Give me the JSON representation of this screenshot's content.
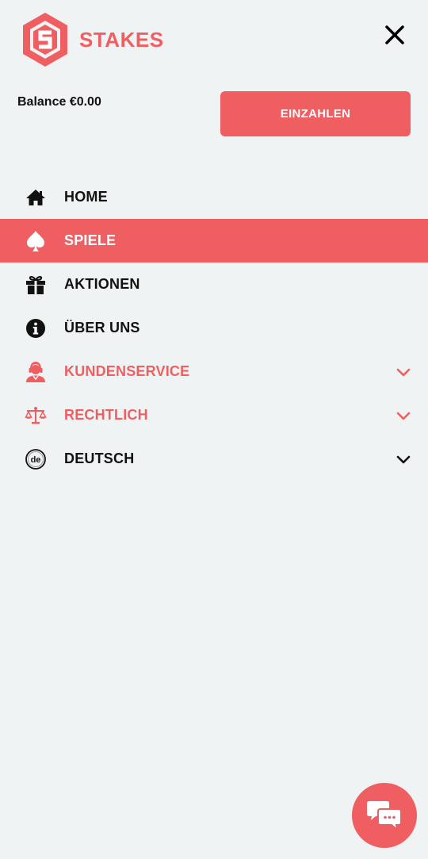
{
  "brand": {
    "name": "STAKES",
    "accent_color": "#ef5f62"
  },
  "header": {
    "close_icon": "close-icon"
  },
  "account": {
    "balance_text": "Balance €0.00",
    "deposit_label": "EINZAHLEN"
  },
  "menu": {
    "items": [
      {
        "label": "HOME",
        "icon": "home-icon",
        "active": false
      },
      {
        "label": "SPIELE",
        "icon": "spade-icon",
        "active": true
      },
      {
        "label": "AKTIONEN",
        "icon": "gift-icon",
        "active": false
      },
      {
        "label": "ÜBER UNS",
        "icon": "info-icon",
        "active": false
      },
      {
        "label": "KUNDENSERVICE",
        "icon": "support-agent-icon",
        "active": false,
        "expandable": true
      },
      {
        "label": "RECHTLICH",
        "icon": "scales-icon",
        "active": false,
        "expandable": true
      },
      {
        "label": "DEUTSCH",
        "icon": "language-de-icon",
        "active": false,
        "expandable": true
      }
    ],
    "language_badge": "de"
  },
  "chat": {
    "icon": "chat-bubbles-icon"
  }
}
